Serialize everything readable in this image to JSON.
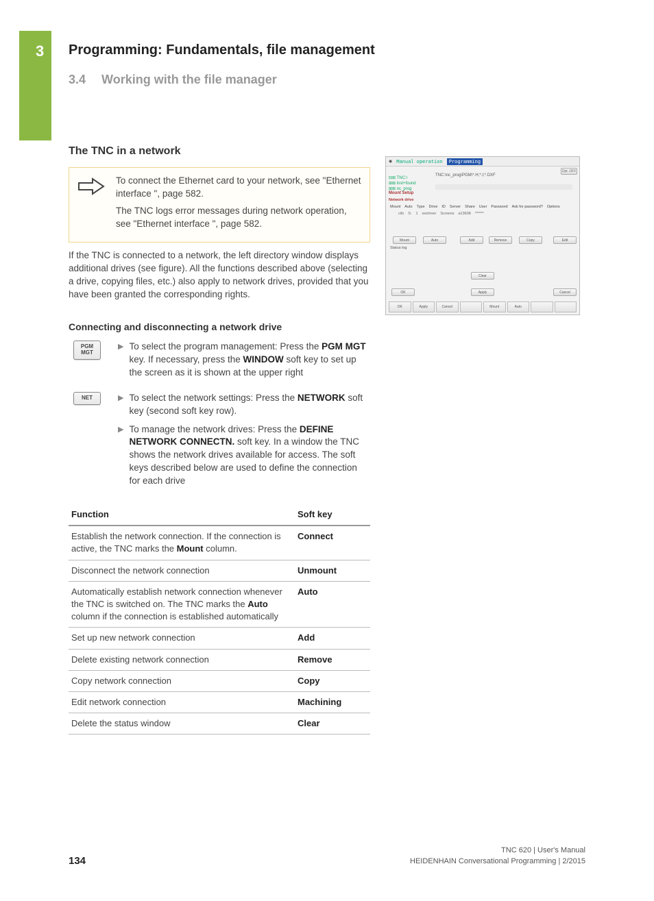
{
  "chapter": {
    "num": "3",
    "title": "Programming: Fundamentals, file management"
  },
  "section": {
    "num": "3.4",
    "title": "Working with the file manager"
  },
  "h_network": "The TNC in a network",
  "note": {
    "p1a": "To connect the Ethernet card to your network, see \"Ethernet interface \", page 582.",
    "p1b": "The TNC logs error messages during network operation, see \"Ethernet interface \", page 582."
  },
  "body_p1": "If the TNC is connected to a network, the left directory window displays additional drives (see figure). All the functions described above (selecting a drive, copying files, etc.) also apply to network drives, provided that you have been granted the corresponding rights.",
  "h_connect": "Connecting and disconnecting a network drive",
  "keys": {
    "pgm_mgt": "PGM\nMGT",
    "net": "NET"
  },
  "steps": {
    "s1_pre": "To select the program management: Press the ",
    "s1_b1": "PGM MGT",
    "s1_mid": " key. If necessary, press the ",
    "s1_b2": "WINDOW",
    "s1_post": " soft key to set up the screen as it is shown at the upper right",
    "s2_pre": "To select the network settings: Press the ",
    "s2_b1": "NETWORK",
    "s2_post": " soft key (second soft key row).",
    "s3_pre": "To manage the network drives: Press the ",
    "s3_b1": "DEFINE NETWORK CONNECTN.",
    "s3_post": " soft key. In a window the TNC shows the network drives available for access. The soft keys described below are used to define the connection for each drive"
  },
  "table": {
    "h1": "Function",
    "h2": "Soft key",
    "rows": [
      {
        "f_pre": "Establish the network connection. If the connection is active, the TNC marks the ",
        "f_b": "Mount",
        "f_post": " column.",
        "sk": "Connect"
      },
      {
        "f_pre": "Disconnect the network connection",
        "f_b": "",
        "f_post": "",
        "sk": "Unmount"
      },
      {
        "f_pre": "Automatically establish network connection whenever the TNC is switched on. The TNC marks the ",
        "f_b": "Auto",
        "f_post": " column if the connection is established automatically",
        "sk": "Auto"
      },
      {
        "f_pre": "Set up new network connection",
        "f_b": "",
        "f_post": "",
        "sk": "Add"
      },
      {
        "f_pre": "Delete existing network connection",
        "f_b": "",
        "f_post": "",
        "sk": "Remove"
      },
      {
        "f_pre": "Copy network connection",
        "f_b": "",
        "f_post": "",
        "sk": "Copy"
      },
      {
        "f_pre": "Edit network connection",
        "f_b": "",
        "f_post": "",
        "sk": "Machining"
      },
      {
        "f_pre": "Delete the status window",
        "f_b": "",
        "f_post": "",
        "sk": "Clear"
      }
    ]
  },
  "figure": {
    "mode_manual": "Manual operation",
    "mode_prog": "Programming",
    "side_off": "Opt. OFF",
    "left1": "⊟⊞ TNC:\\",
    "left2": "  ⊞⊞ lost+found",
    "left3": "  ⊞⊞ nc_prog",
    "hdr": "Mount Setup",
    "path": "TNC:\\nc_prog\\PGM\\*.H;*.I;*.DXF",
    "grp": "Network drive",
    "cols": [
      "Mount",
      "Auto",
      "Type",
      "Drive",
      "ID",
      "Server",
      "Share",
      "User",
      "Password",
      "Ask for password?",
      "Options"
    ],
    "row": [
      "",
      "",
      "cifs",
      "S:",
      "1",
      "zeichner",
      "Screens",
      "a13608",
      "******",
      "",
      ""
    ],
    "btns": {
      "mount": "Mount",
      "auto": "Auto",
      "add": "Add",
      "remove": "Remove",
      "copy": "Copy",
      "edit": "Edit",
      "clear": "Clear",
      "apply": "Apply",
      "ok": "OK",
      "cancel": "Cancel"
    },
    "statlog": "Status log",
    "soft": [
      "OK",
      "Apply",
      "Cancel",
      "",
      "Mount",
      "Auto",
      "",
      ""
    ]
  },
  "footer": {
    "page": "134",
    "r1": "TNC 620 | User's Manual",
    "r2": "HEIDENHAIN Conversational Programming | 2/2015"
  }
}
